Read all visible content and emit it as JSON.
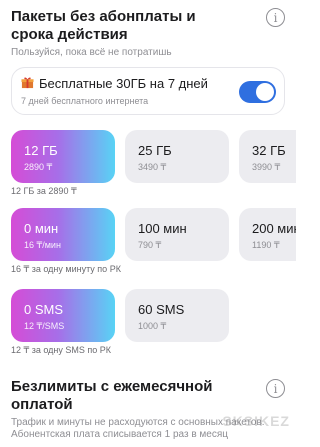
{
  "section1": {
    "title": "Пакеты без абонплаты и срока действия",
    "subtitle": "Пользуйся, пока всё не потратишь"
  },
  "promo": {
    "title": "Бесплатные 30ГБ на 7 дней",
    "subtitle": "7 дней бесплатного интернета",
    "toggle_on": true,
    "accent_color": "#2f6fe0"
  },
  "data_packages": {
    "tiles": [
      {
        "amount": "12 ГБ",
        "price": "2890 ₸",
        "selected": true
      },
      {
        "amount": "25 ГБ",
        "price": "3490 ₸",
        "selected": false
      },
      {
        "amount": "32 ГБ",
        "price": "3990 ₸",
        "selected": false
      }
    ],
    "caption": "12 ГБ за 2890 ₸"
  },
  "minute_packages": {
    "tiles": [
      {
        "amount": "0 мин",
        "price": "16 ₸/мин",
        "selected": true
      },
      {
        "amount": "100 мин",
        "price": "790 ₸",
        "selected": false
      },
      {
        "amount": "200 мин",
        "price": "1190 ₸",
        "selected": false
      }
    ],
    "caption": "16 ₸ за одну минуту по РК"
  },
  "sms_packages": {
    "tiles": [
      {
        "amount": "0 SMS",
        "price": "12 ₸/SMS",
        "selected": true
      },
      {
        "amount": "60 SMS",
        "price": "1000 ₸",
        "selected": false
      }
    ],
    "caption": "12 ₸ за одну SMS  по РК"
  },
  "section2": {
    "title": "Безлимиты с ежемесячной оплатой",
    "subtitle": "Трафик и минуты не расходуются с основных пакетов. Абонентская плата списывается 1 раз в месяц"
  },
  "icons": {
    "info": "info-icon",
    "gift": "gift-icon"
  },
  "watermark": "SKSIKEZ"
}
